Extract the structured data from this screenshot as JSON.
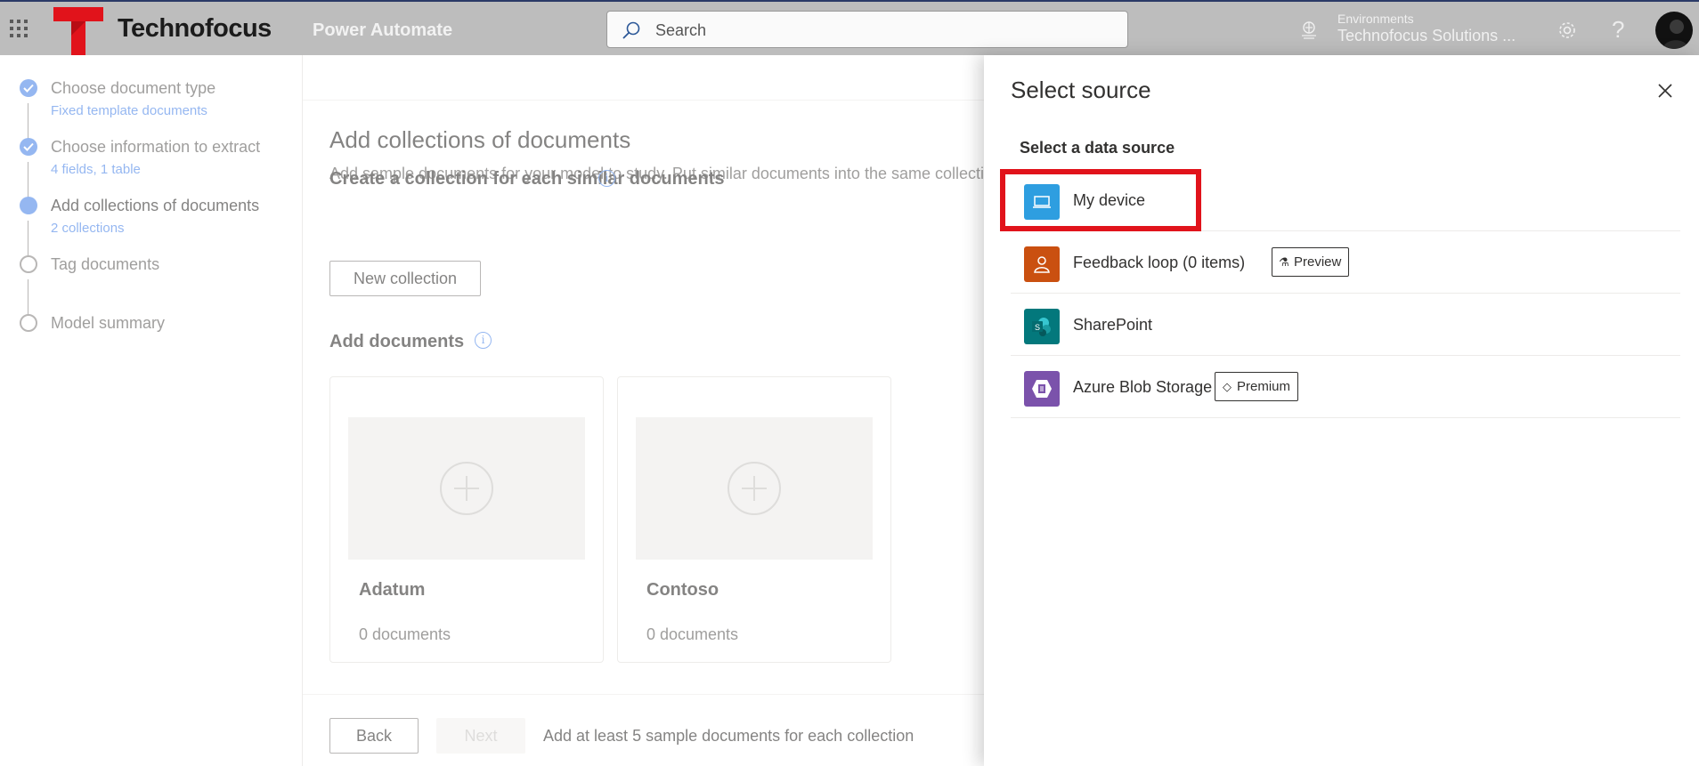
{
  "topbar": {
    "brand": "Technofocus",
    "app_name": "Power Automate",
    "search_placeholder": "Search",
    "env_label": "Environments",
    "env_name": "Technofocus Solutions ...",
    "help": "?"
  },
  "stepper": {
    "steps": [
      {
        "title": "Choose document type",
        "subtitle": "Fixed template documents",
        "state": "done"
      },
      {
        "title": "Choose information to extract",
        "subtitle": "4 fields, 1 table",
        "state": "done"
      },
      {
        "title": "Add collections of documents",
        "subtitle": "2 collections",
        "state": "current"
      },
      {
        "title": "Tag documents",
        "subtitle": "",
        "state": "todo"
      },
      {
        "title": "Model summary",
        "subtitle": "",
        "state": "todo"
      }
    ]
  },
  "main": {
    "title": "Add collections of documents",
    "description": "Add sample documents for your model to study. Put similar documents into the same collection.",
    "create_heading": "Create a collection for each similar documents",
    "new_collection_label": "New collection",
    "add_docs_heading": "Add documents",
    "info_glyph": "i",
    "collections": [
      {
        "name": "Adatum",
        "count": "0 documents"
      },
      {
        "name": "Contoso",
        "count": "0 documents"
      }
    ],
    "back_label": "Back",
    "next_label": "Next",
    "hint": "Add at least 5 sample documents for each collection"
  },
  "panel": {
    "title": "Select source",
    "subtitle": "Select a data source",
    "sources": [
      {
        "label": "My device",
        "icon": "laptop-icon",
        "color": "#2e9ee0",
        "badge": ""
      },
      {
        "label": "Feedback loop (0 items)",
        "icon": "person-icon",
        "color": "#ca5010",
        "badge": "Preview",
        "badge_icon": "flask-icon"
      },
      {
        "label": "SharePoint",
        "icon": "sharepoint-icon",
        "color": "#03787c",
        "badge": ""
      },
      {
        "label": "Azure Blob Storage",
        "icon": "blob-storage-icon",
        "color": "#7b52ab",
        "badge": "Premium",
        "badge_icon": "diamond-icon"
      }
    ]
  },
  "colors": {
    "accent": "#4f87e8",
    "highlight": "#e1131b",
    "topbar": "#bdbdbd",
    "logo_red": "#e1131b"
  }
}
